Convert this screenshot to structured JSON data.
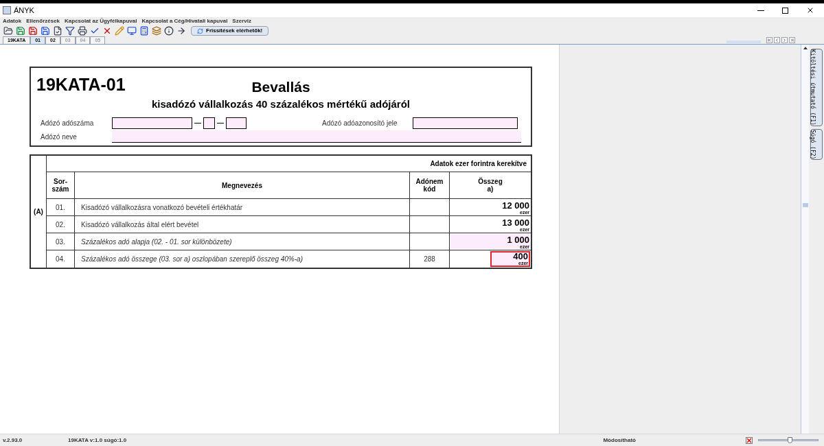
{
  "window": {
    "title": "ÁNYK"
  },
  "menu": [
    "Adatok",
    "Ellenőrzések",
    "Kapcsolat az Ügyfélkapuval",
    "Kapcsolat a Cég/Hivatali kapuval",
    "Szerviz"
  ],
  "toolbar": {
    "update_button": "Frissítések elérhetők!"
  },
  "tabs": [
    {
      "label": "19KATA",
      "selected": false,
      "disabled": false
    },
    {
      "label": "01",
      "selected": true,
      "disabled": false
    },
    {
      "label": "02",
      "selected": false,
      "disabled": false
    },
    {
      "label": "03",
      "selected": false,
      "disabled": true
    },
    {
      "label": "04",
      "selected": false,
      "disabled": true
    },
    {
      "label": "05",
      "selected": false,
      "disabled": true
    }
  ],
  "form": {
    "code": "19KATA-01",
    "title": "Bevallás",
    "subtitle": "kisadózó vállalkozás 40 százalékos mértékű adójáról",
    "tax_number_label": "Adózó adószáma",
    "tax_id_label": "Adózó adóazonosító jele",
    "name_label": "Adózó neve",
    "section": "(A)",
    "note": "Adatok ezer forintra kerekítve",
    "columns": [
      "Sor-\nszám",
      "Megnevezés",
      "Adónem\nkód",
      "Összeg\na)"
    ],
    "rows": [
      {
        "number": "01.",
        "text": "Kisadózó vállalkozásra vonatkozó bevételi értékhatár",
        "code": "",
        "amount": "12 000",
        "unit": "ezer",
        "italic": false,
        "editable": false,
        "focused": false
      },
      {
        "number": "02.",
        "text": "Kisadózó vállalkozás által elért bevétel",
        "code": "",
        "amount": "13 000",
        "unit": "ezer",
        "italic": false,
        "editable": false,
        "focused": false
      },
      {
        "number": "03.",
        "text": "Százalékos adó alapja (02. - 01. sor különbözete)",
        "code": "",
        "amount": "1 000",
        "unit": "ezer",
        "italic": true,
        "editable": true,
        "focused": false
      },
      {
        "number": "04.",
        "text": "Százalékos adó összege (03. sor a) oszlopában szereplő összeg 40%-a)",
        "code": "288",
        "amount": "400",
        "unit": "ezer",
        "italic": true,
        "editable": true,
        "focused": true
      }
    ]
  },
  "side_tabs": [
    "Kitöltési útmutató (F1)",
    "Súgó (F2)"
  ],
  "status_bar": {
    "version": "v.2.93.0",
    "form_version": "19KATA v:1.0 súgó:1.0",
    "mode": "Módosítható",
    "zoom": {
      "level": 0.52
    }
  }
}
